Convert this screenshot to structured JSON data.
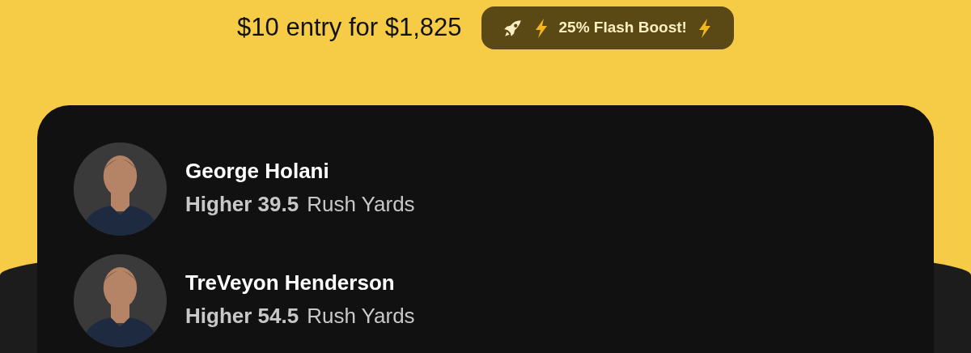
{
  "entry": {
    "text": "$10 entry for $1,825"
  },
  "boost": {
    "label": "25% Flash Boost!"
  },
  "picks": [
    {
      "player": "George Holani",
      "selection": "Higher 39.5",
      "stat": "Rush Yards"
    },
    {
      "player": "TreVeyon Henderson",
      "selection": "Higher 54.5",
      "stat": "Rush Yards"
    }
  ]
}
